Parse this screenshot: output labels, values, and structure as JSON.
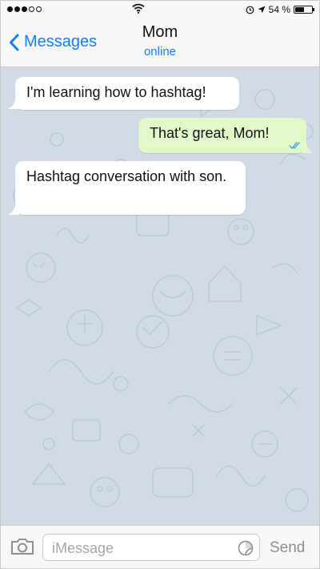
{
  "status_bar": {
    "battery_text": "54 %",
    "battery_level": 0.54
  },
  "header": {
    "back_label": "Messages",
    "title": "Mom",
    "subtitle": "online"
  },
  "messages": [
    {
      "direction": "incoming",
      "text": "I'm learning how to hashtag!"
    },
    {
      "direction": "outgoing",
      "text": "That's great, Mom!",
      "status": "read"
    },
    {
      "direction": "incoming",
      "text": "Hashtag conversation with son."
    }
  ],
  "composer": {
    "placeholder": "iMessage",
    "send_label": "Send"
  },
  "colors": {
    "accent": "#157efb",
    "chat_background": "#d1dbe5",
    "incoming_bubble": "#ffffff",
    "outgoing_bubble": "#e1f9c9",
    "read_check": "#4aa3df"
  },
  "icons": {
    "signal": "signal-dots-icon",
    "wifi": "wifi-icon",
    "alarm": "alarm-icon",
    "location": "location-arrow-icon",
    "battery": "battery-icon",
    "back": "chevron-left-icon",
    "camera": "camera-icon",
    "sticker": "sticker-icon",
    "read": "double-check-icon"
  }
}
